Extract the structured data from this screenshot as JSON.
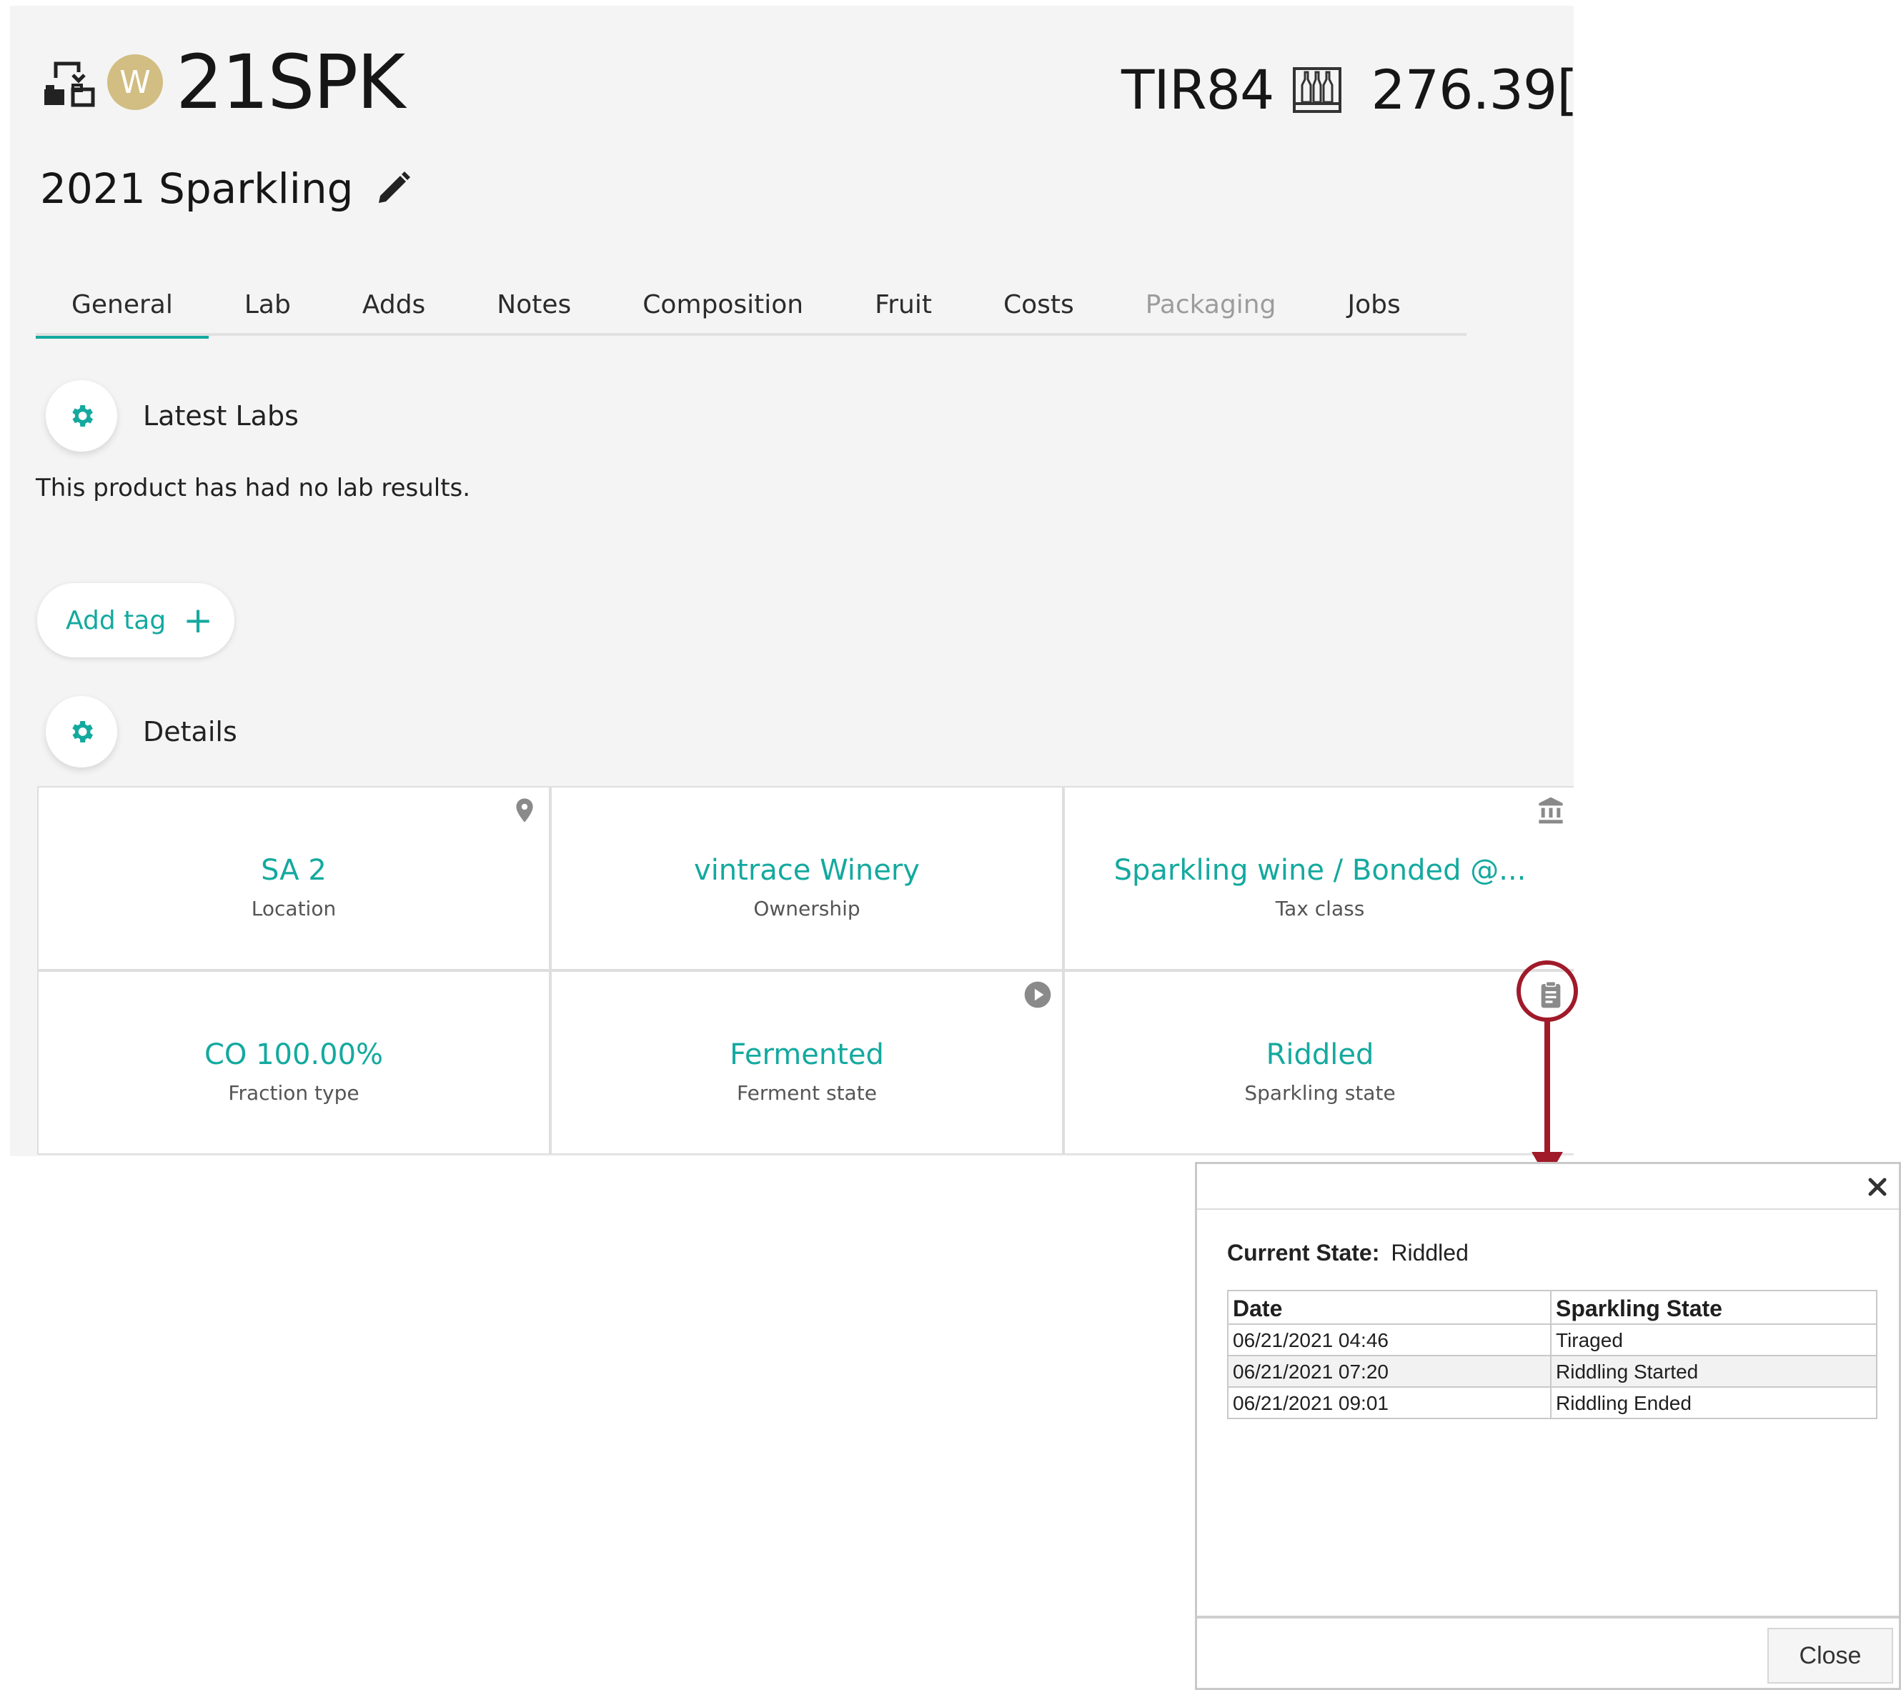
{
  "header": {
    "avatar_letter": "W",
    "product_code": "21SPK",
    "vessel_code": "TIR84",
    "volume": "276.39[",
    "subtitle": "2021 Sparkling"
  },
  "tabs": [
    {
      "label": "General",
      "active": true
    },
    {
      "label": "Lab"
    },
    {
      "label": "Adds"
    },
    {
      "label": "Notes"
    },
    {
      "label": "Composition"
    },
    {
      "label": "Fruit"
    },
    {
      "label": "Costs"
    },
    {
      "label": "Packaging",
      "disabled": true
    },
    {
      "label": "Jobs"
    }
  ],
  "latest_labs": {
    "title": "Latest Labs",
    "empty_text": "This product has had no lab results."
  },
  "add_tag": {
    "label": "Add tag",
    "icon": "plus-icon"
  },
  "details": {
    "title": "Details",
    "cells": [
      {
        "value": "SA 2",
        "label": "Location",
        "icon": "map-pin-icon"
      },
      {
        "value": "vintrace Winery",
        "label": "Ownership"
      },
      {
        "value": "Sparkling wine / Bonded @...",
        "label": "Tax class",
        "icon": "bank-icon"
      },
      {
        "value": "CO 100.00%",
        "label": "Fraction type"
      },
      {
        "value": "Fermented",
        "label": "Ferment state",
        "icon": "play-circle-icon"
      },
      {
        "value": "Riddled",
        "label": "Sparkling state",
        "icon": "clipboard-icon"
      }
    ]
  },
  "dialog": {
    "current_state_label": "Current State:",
    "current_state_value": "Riddled",
    "columns": [
      "Date",
      "Sparkling State"
    ],
    "rows": [
      [
        "06/21/2021 04:46",
        "Tiraged"
      ],
      [
        "06/21/2021 07:20",
        "Riddling Started"
      ],
      [
        "06/21/2021 09:01",
        "Riddling Ended"
      ]
    ],
    "close_label": "Close"
  },
  "colors": {
    "accent": "#14a99f",
    "avatar": "#d2bd82",
    "callout": "#a01a2a",
    "panel_bg": "#f4f4f4"
  }
}
